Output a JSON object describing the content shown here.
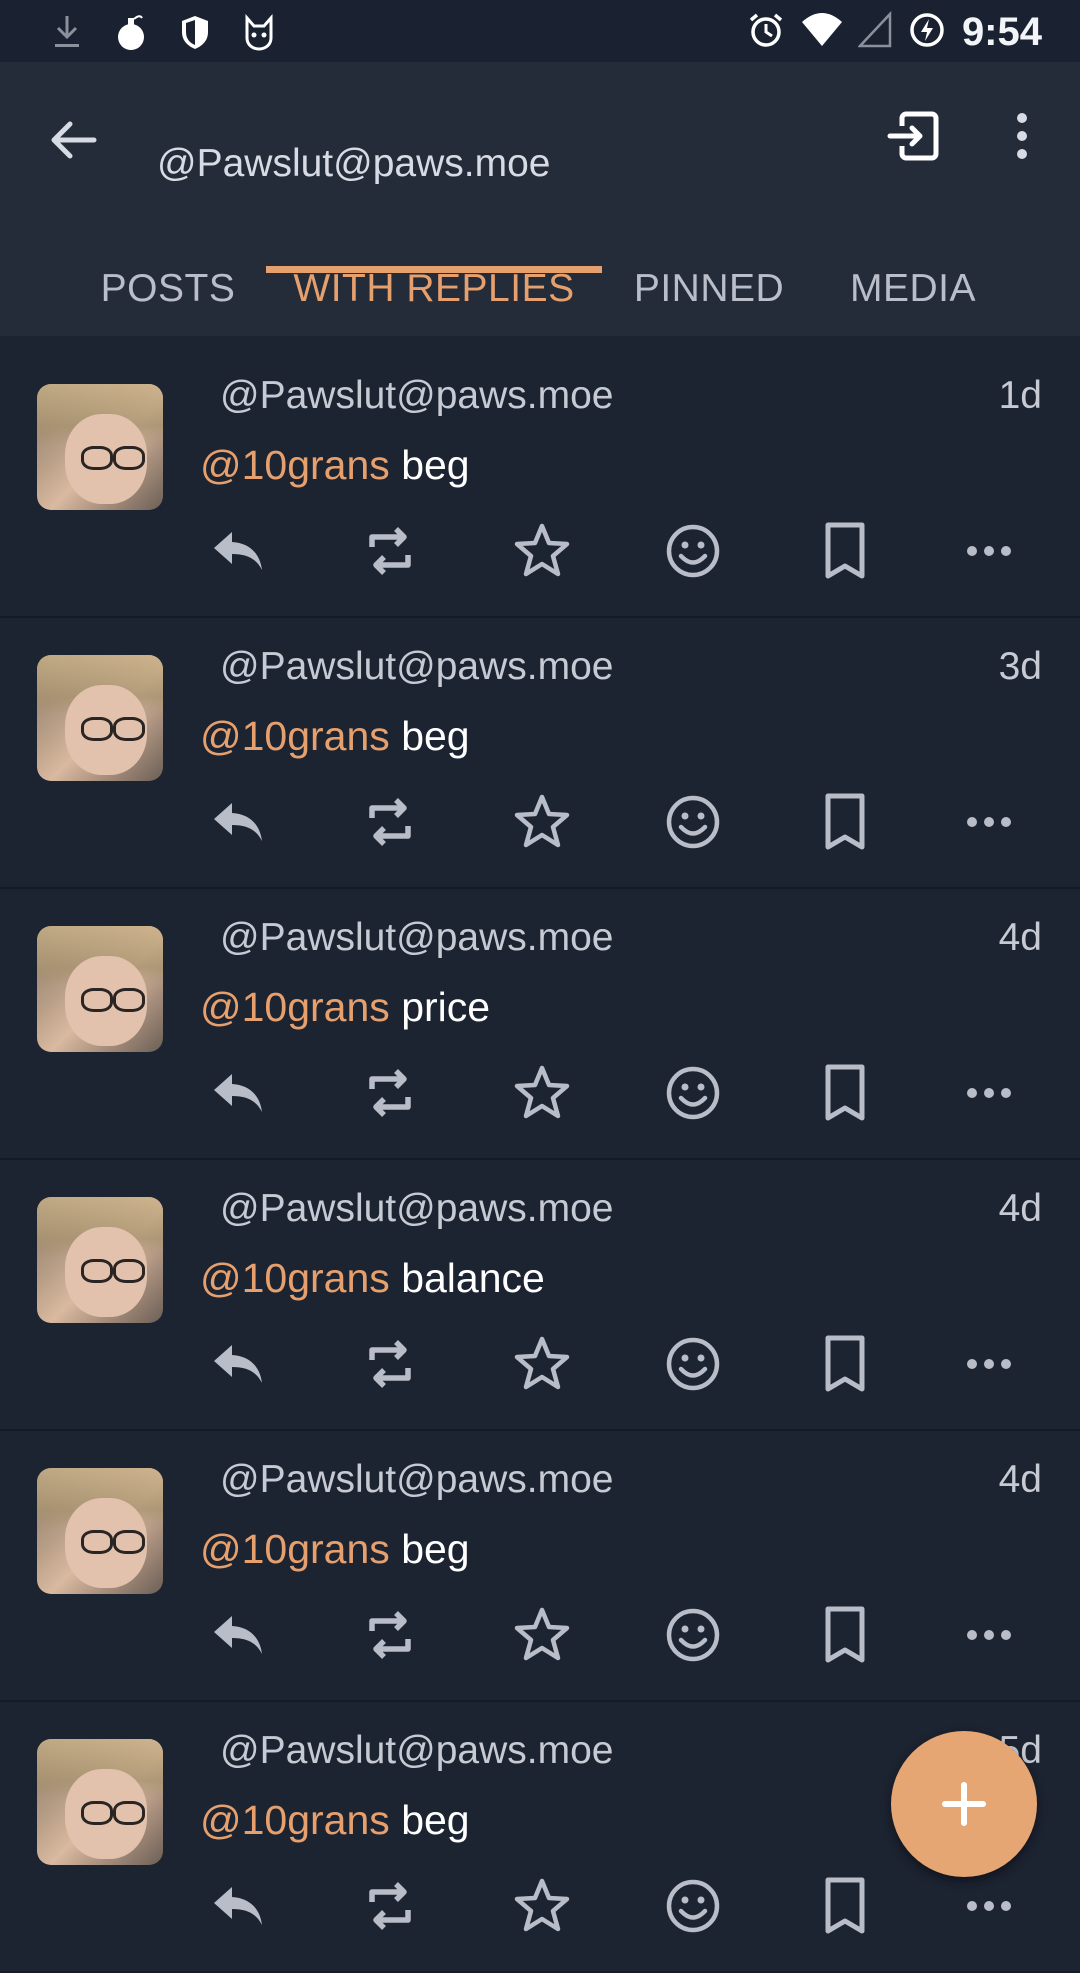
{
  "status_bar": {
    "time": "9:54",
    "left_icons": [
      "download-icon",
      "bomb-icon",
      "shield-icon",
      "cat-icon"
    ],
    "right_icons": [
      "alarm-icon",
      "wifi-icon",
      "signal-icon",
      "battery-saver-icon"
    ]
  },
  "app_bar": {
    "title": "@Pawslut@paws.moe",
    "tabs": [
      {
        "label": "POSTS",
        "active": false
      },
      {
        "label": "WITH REPLIES",
        "active": true
      },
      {
        "label": "PINNED",
        "active": false
      },
      {
        "label": "MEDIA",
        "active": false
      }
    ]
  },
  "colors": {
    "accent": "#e6a06e",
    "background": "#1c2331",
    "appbar": "#242c3a"
  },
  "posts": [
    {
      "author": "@Pawslut@paws.moe",
      "time": "1d",
      "mention": "@10grans",
      "text": "beg"
    },
    {
      "author": "@Pawslut@paws.moe",
      "time": "3d",
      "mention": "@10grans",
      "text": "beg"
    },
    {
      "author": "@Pawslut@paws.moe",
      "time": "4d",
      "mention": "@10grans",
      "text": "price"
    },
    {
      "author": "@Pawslut@paws.moe",
      "time": "4d",
      "mention": "@10grans",
      "text": "balance"
    },
    {
      "author": "@Pawslut@paws.moe",
      "time": "4d",
      "mention": "@10grans",
      "text": "beg"
    },
    {
      "author": "@Pawslut@paws.moe",
      "time": "5d",
      "mention": "@10grans",
      "text": "beg"
    }
  ],
  "post_actions": [
    "reply-icon",
    "boost-icon",
    "favorite-icon",
    "emoji-react-icon",
    "bookmark-icon",
    "more-options-icon"
  ],
  "fab": {
    "icon": "plus-icon"
  }
}
